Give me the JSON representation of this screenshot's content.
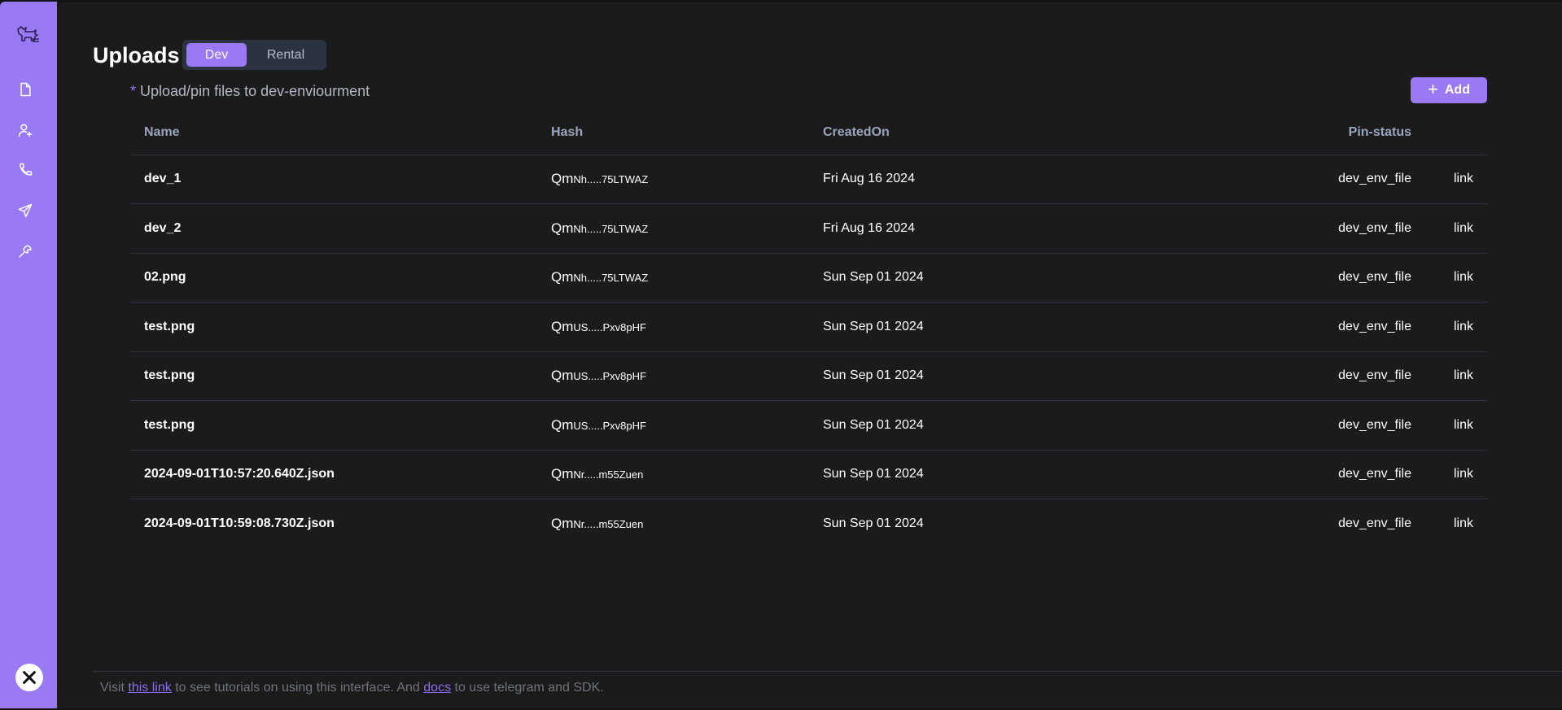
{
  "page": {
    "title": "Uploads",
    "subtitle": "Upload/pin files to dev-enviourment",
    "subtitle_marker": "*",
    "tabs": [
      {
        "label": "Dev",
        "active": true
      },
      {
        "label": "Rental",
        "active": false
      }
    ],
    "add_label": "Add"
  },
  "sidebar": {
    "icons": [
      "logo-icon",
      "file-icon",
      "user-add-icon",
      "phone-icon",
      "send-icon",
      "tools-icon"
    ],
    "close_icon": "close-icon"
  },
  "table": {
    "headers": [
      "Name",
      "Hash",
      "CreatedOn",
      "Pin-status",
      ""
    ],
    "rows": [
      {
        "name": "dev_1",
        "hash_prefix": "Qm",
        "hash_rest": "Nh.....75LTWAZ",
        "created": "Fri Aug 16 2024",
        "pin": "dev_env_file",
        "link": "link"
      },
      {
        "name": "dev_2",
        "hash_prefix": "Qm",
        "hash_rest": "Nh.....75LTWAZ",
        "created": "Fri Aug 16 2024",
        "pin": "dev_env_file",
        "link": "link"
      },
      {
        "name": "02.png",
        "hash_prefix": "Qm",
        "hash_rest": "Nh.....75LTWAZ",
        "created": "Sun Sep 01 2024",
        "pin": "dev_env_file",
        "link": "link"
      },
      {
        "name": "test.png",
        "hash_prefix": "Qm",
        "hash_rest": "US.....Pxv8pHF",
        "created": "Sun Sep 01 2024",
        "pin": "dev_env_file",
        "link": "link"
      },
      {
        "name": "test.png",
        "hash_prefix": "Qm",
        "hash_rest": "US.....Pxv8pHF",
        "created": "Sun Sep 01 2024",
        "pin": "dev_env_file",
        "link": "link"
      },
      {
        "name": "test.png",
        "hash_prefix": "Qm",
        "hash_rest": "US.....Pxv8pHF",
        "created": "Sun Sep 01 2024",
        "pin": "dev_env_file",
        "link": "link"
      },
      {
        "name": "2024-09-01T10:57:20.640Z.json",
        "hash_prefix": "Qm",
        "hash_rest": "Nr.....m55Zuen",
        "created": "Sun Sep 01 2024",
        "pin": "dev_env_file",
        "link": "link"
      },
      {
        "name": "2024-09-01T10:59:08.730Z.json",
        "hash_prefix": "Qm",
        "hash_rest": "Nr.....m55Zuen",
        "created": "Sun Sep 01 2024",
        "pin": "dev_env_file",
        "link": "link"
      }
    ]
  },
  "footer": {
    "text_1": "Visit ",
    "link_1": "this link",
    "text_2": " to see tutorials on using this interface. And ",
    "link_2": "docs",
    "text_3": " to use telegram and SDK."
  },
  "colors": {
    "accent": "#9a79f5",
    "background": "#1b1b1b",
    "header_text": "#9aa6bd"
  }
}
